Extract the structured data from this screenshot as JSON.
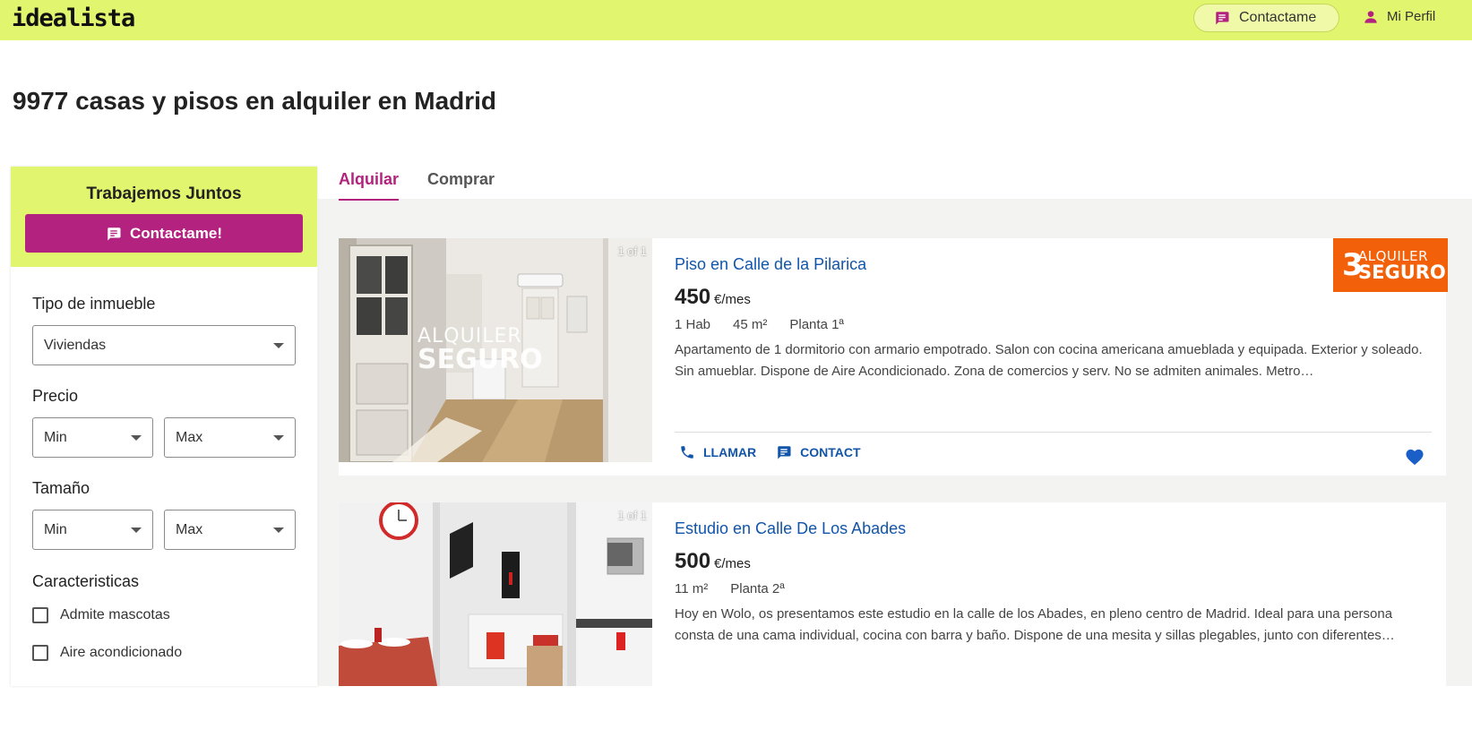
{
  "header": {
    "logo": "idealista",
    "contact_label": "Contactame",
    "profile_label": "Mi Perfil"
  },
  "page_title": "9977 casas y pisos en alquiler en Madrid",
  "sidebar": {
    "promo_title": "Trabajemos Juntos",
    "promo_button": "Contactame!",
    "tipo_label": "Tipo de inmueble",
    "tipo_value": "Viviendas",
    "precio_label": "Precio",
    "precio_min": "Min",
    "precio_max": "Max",
    "tamano_label": "Tamaño",
    "tamano_min": "Min",
    "tamano_max": "Max",
    "caracteristicas_label": "Caracteristicas",
    "checkbox_1": "Admite mascotas",
    "checkbox_2": "Aire acondicionado"
  },
  "tabs": {
    "alquilar": "Alquilar",
    "comprar": "Comprar"
  },
  "listings": [
    {
      "image_counter": "1 of 1",
      "watermark_1": "ALQUILER",
      "watermark_2": "SEGURO",
      "title": "Piso en Calle de la Pilarica",
      "price": "450",
      "price_unit": "€/mes",
      "details": [
        "1 Hab",
        "45 m²",
        "Planta 1ª"
      ],
      "description": "Apartamento de 1 dormitorio con armario empotrado. Salon con cocina americana amueblada y equipada. Exterior y soleado. Sin amueblar. Dispone de Aire Acondicionado. Zona de comercios y serv. No se admiten animales. Metro…",
      "call_label": "LLAMAR",
      "contact_label": "CONTACT",
      "badge_1": "ALQUILER",
      "badge_2": "SEGURO",
      "badge_3": "3"
    },
    {
      "image_counter": "1 of 1",
      "title": "Estudio en Calle De Los Abades",
      "price": "500",
      "price_unit": "€/mes",
      "details": [
        "11 m²",
        "Planta 2ª"
      ],
      "description": "Hoy en Wolo, os presentamos este estudio en la calle de los Abades, en pleno centro de Madrid. Ideal para una persona consta de una cama individual, cocina con barra y baño. Dispone de una mesita y sillas plegables, junto con diferentes…"
    }
  ],
  "colors": {
    "brand_lime": "#e1f56e",
    "brand_magenta": "#b3227e",
    "link_blue": "#1155aa",
    "badge_orange": "#f2610a"
  },
  "icons": [
    "chat-icon",
    "person-icon",
    "phone-icon",
    "message-icon",
    "heart-icon",
    "chevron-down-icon"
  ]
}
